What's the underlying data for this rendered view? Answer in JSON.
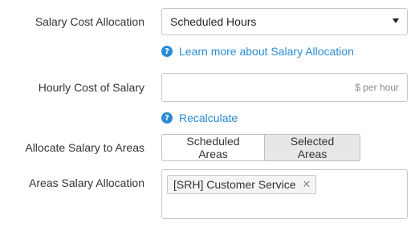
{
  "salary_cost_allocation": {
    "label": "Salary Cost Allocation",
    "selected": "Scheduled Hours",
    "help_link": "Learn more about Salary Allocation"
  },
  "hourly_cost": {
    "label": "Hourly Cost of Salary",
    "value": "",
    "placeholder": "$ per hour",
    "help_link": "Recalculate"
  },
  "allocate_to_areas": {
    "label": "Allocate Salary to Areas",
    "options": [
      "Scheduled Areas",
      "Selected Areas"
    ],
    "selected": "Selected Areas"
  },
  "areas_salary_allocation": {
    "label": "Areas Salary Allocation",
    "tags": [
      "[SRH] Customer Service"
    ]
  },
  "colors": {
    "link": "#2a8bd2",
    "active_button": "#e7e7e7",
    "border": "#c8c8c8"
  }
}
